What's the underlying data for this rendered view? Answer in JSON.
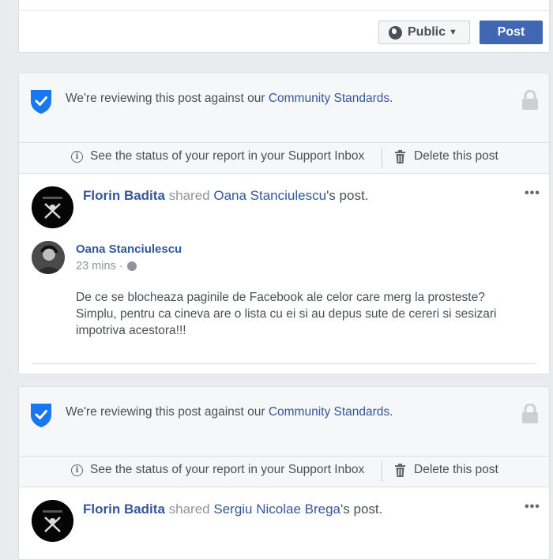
{
  "composer": {
    "privacy_label": "Public",
    "post_label": "Post"
  },
  "review_notice": {
    "text_prefix": "We're reviewing this post against our ",
    "link_text": "Community Standards",
    "text_suffix": "."
  },
  "report_actions": {
    "status_label": "See the status of your report in your Support Inbox",
    "delete_label": "Delete this post"
  },
  "posts": [
    {
      "author": "Florin Badita",
      "shared_word": "shared",
      "shared_owner": "Oana Stanciulescu",
      "shared_suffix": "'s post.",
      "inner": {
        "name": "Oana Stanciulescu",
        "time": "23 mins",
        "separator": "·",
        "text": "De ce se blocheaza paginile de Facebook ale celor care merg la prosteste? Simplu, pentru ca cineva are o lista cu ei si au depus sute de cereri si sesizari impotriva acestora!!!"
      }
    },
    {
      "author": "Florin Badita",
      "shared_word": "shared",
      "shared_owner": "Sergiu Nicolae Brega",
      "shared_suffix": "'s post."
    }
  ],
  "more_options_glyph": "•••",
  "colors": {
    "brand_blue": "#4267b2",
    "link_blue": "#365899",
    "banner_bg": "#f6f7f9",
    "page_bg": "#e9ebee",
    "shield_blue": "#1877f2"
  },
  "icons": [
    "globe-icon",
    "caret-down-icon",
    "shield-check-icon",
    "lock-icon",
    "info-icon",
    "trash-icon",
    "more-options-icon",
    "audience-globe-icon"
  ]
}
